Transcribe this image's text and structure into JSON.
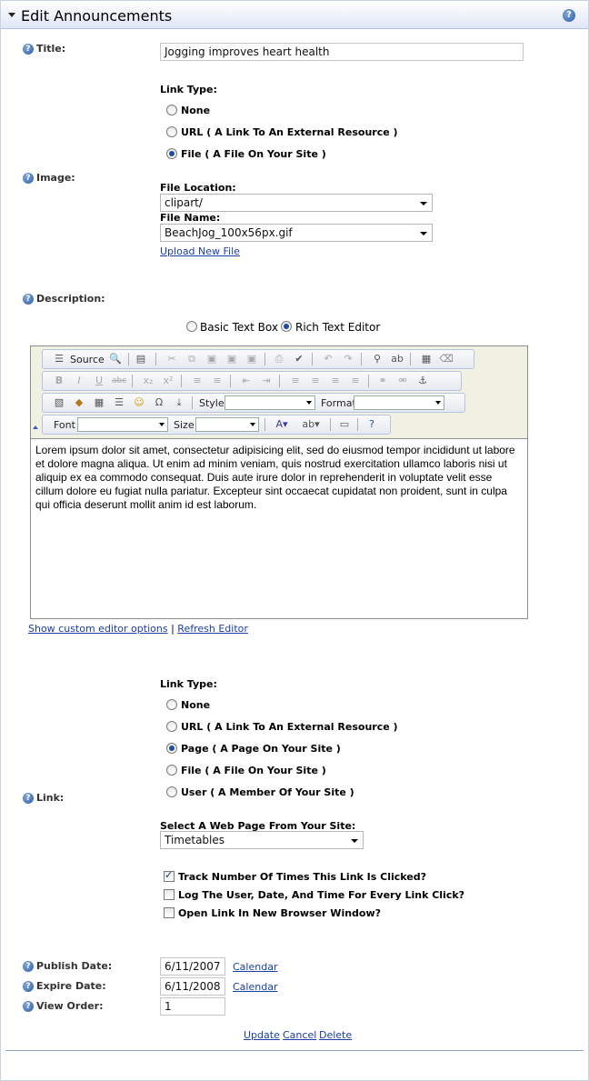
{
  "header": {
    "title": "Edit Announcements",
    "help": "?"
  },
  "title_field": {
    "label": "Title:",
    "value": "Jogging improves heart health"
  },
  "image_link": {
    "link_type_label": "Link Type:",
    "options": [
      "None",
      "URL ( A Link To An External Resource )",
      "File ( A File On Your Site )"
    ],
    "selected": 2,
    "image_label": "Image:",
    "file_location_label": "File Location:",
    "file_location_value": "clipart/",
    "file_name_label": "File Name:",
    "file_name_value": "BeachJog_100x56px.gif",
    "upload_link": "Upload New File"
  },
  "description": {
    "label": "Description:",
    "mode_options": [
      "Basic Text Box",
      "Rich Text Editor"
    ],
    "selected_mode": 1,
    "toolbar": {
      "source": "Source",
      "style": "Style",
      "format": "Format",
      "font": "Font",
      "size": "Size"
    },
    "body": "Lorem ipsum dolor sit amet, consectetur adipisicing elit, sed do eiusmod tempor incididunt ut labore et dolore magna aliqua. Ut enim ad minim veniam, quis nostrud exercitation ullamco laboris nisi ut aliquip ex ea commodo consequat. Duis aute irure dolor in reprehenderit in voluptate velit esse cillum dolore eu fugiat nulla pariatur. Excepteur sint occaecat cupidatat non proident, sunt in culpa qui officia deserunt mollit anim id est laborum.",
    "show_options_link": "Show custom editor options",
    "separator": "|",
    "refresh_link": "Refresh Editor"
  },
  "link": {
    "label": "Link:",
    "link_type_label": "Link Type:",
    "options": [
      "None",
      "URL ( A Link To An External Resource )",
      "Page ( A Page On Your Site )",
      "File ( A File On Your Site )",
      "User ( A Member Of Your Site )"
    ],
    "selected": 2,
    "page_label": "Select A Web Page From Your Site:",
    "page_value": "Timetables",
    "track_label": "Track Number Of Times This Link Is Clicked?",
    "log_label": "Log The User, Date, And Time For Every Link Click?",
    "newwin_label": "Open Link In New Browser Window?",
    "track_checked": true,
    "log_checked": false,
    "newwin_checked": false
  },
  "dates": {
    "publish_label": "Publish Date:",
    "publish_value": "6/11/2007",
    "expire_label": "Expire Date:",
    "expire_value": "6/11/2008",
    "order_label": "View Order:",
    "order_value": "1",
    "calendar": "Calendar"
  },
  "actions": {
    "update": "Update",
    "cancel": "Cancel",
    "delete": "Delete"
  }
}
